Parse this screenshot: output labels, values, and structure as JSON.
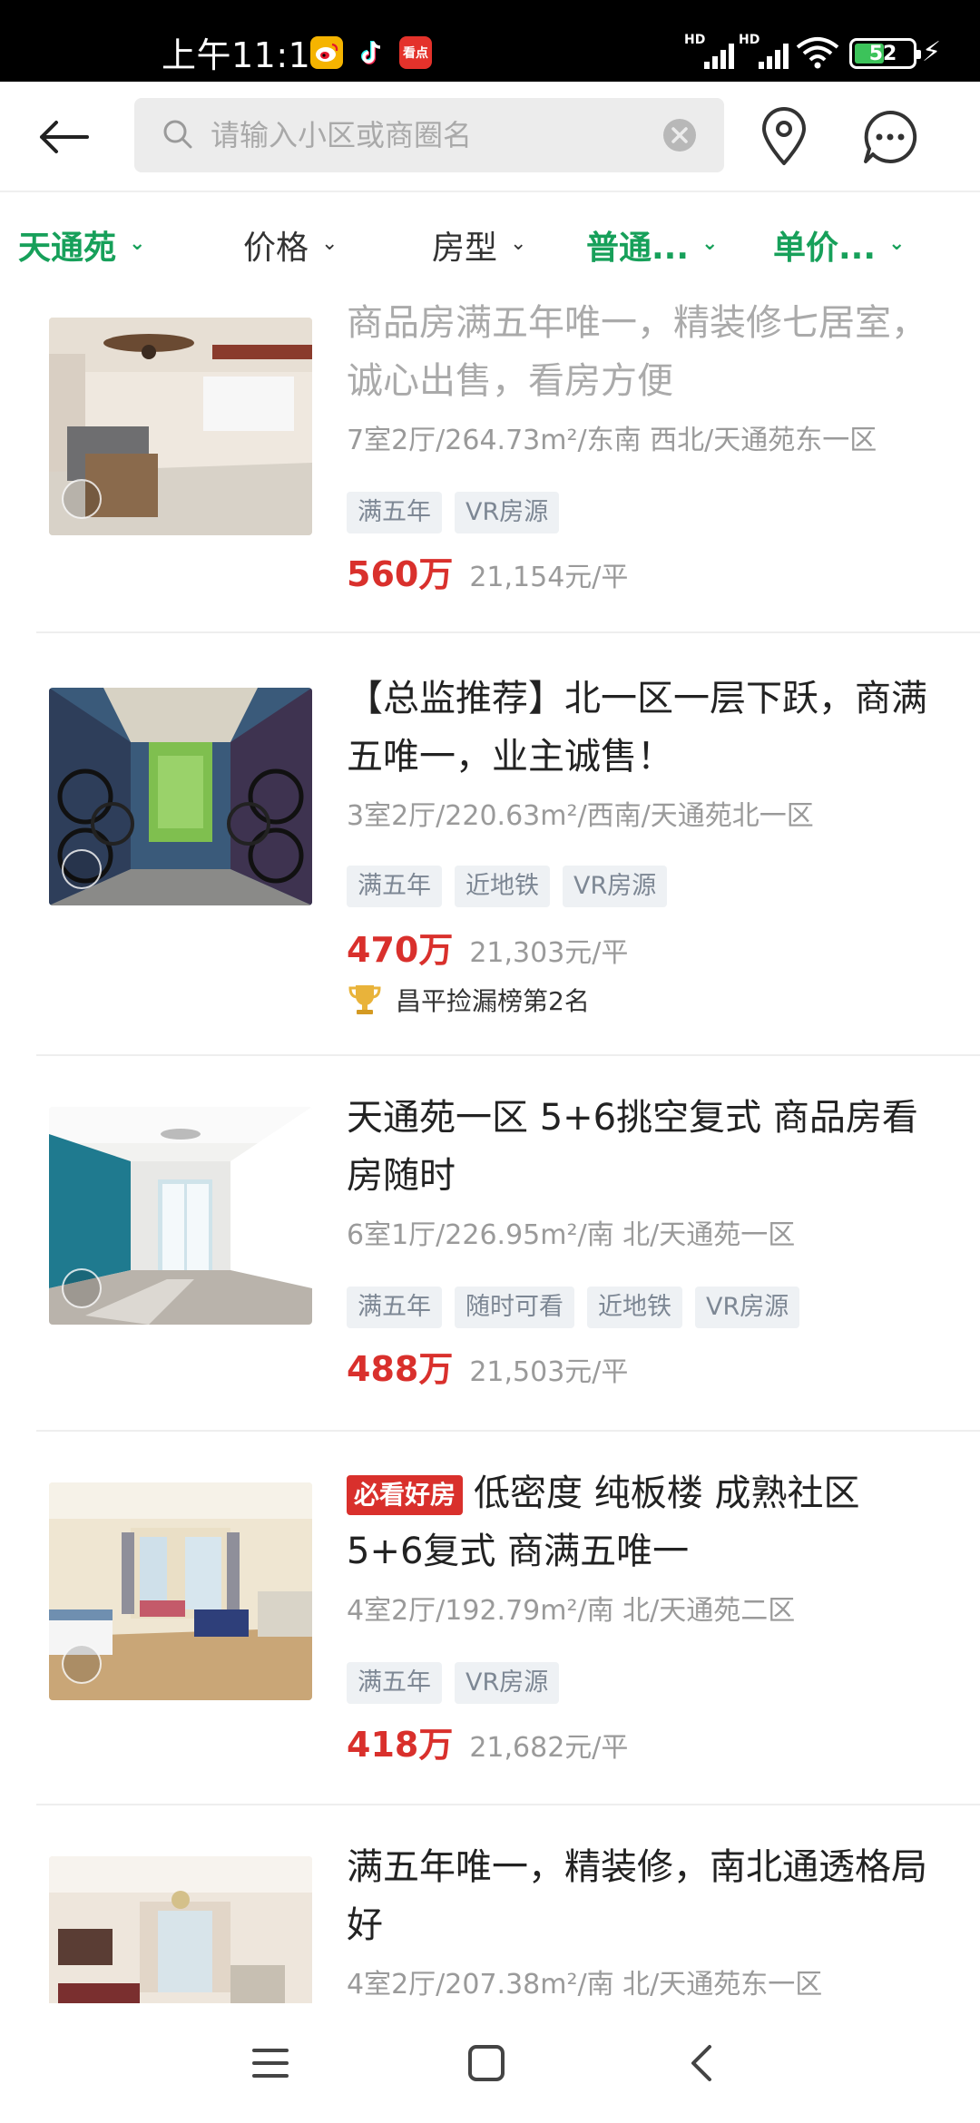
{
  "status_bar": {
    "time": "上午11:10",
    "weibo_icon": "weibo-icon",
    "tiktok_icon": "tiktok-icon",
    "kandian_label": "看点",
    "signal_label_1": "HD",
    "signal_label_2": "HD",
    "battery_level": "52",
    "battery_fraction": 0.52
  },
  "header": {
    "back_icon": "arrow-left-icon",
    "search_placeholder": "请输入小区或商圈名",
    "location_icon": "location-pin-icon",
    "message_icon": "chat-bubble-icon"
  },
  "filters": [
    {
      "label": "天通苑",
      "active": true
    },
    {
      "label": "价格",
      "active": false
    },
    {
      "label": "房型",
      "active": false
    },
    {
      "label": "普通...",
      "active": true
    },
    {
      "label": "单价...",
      "active": true
    }
  ],
  "colors": {
    "accent_green": "#17a05a",
    "price_red": "#d9302c",
    "tag_bg": "#eef1f4",
    "tag_text": "#7d8794"
  },
  "listings": [
    {
      "title": "商品房满五年唯一，精装修七居室，诚心出售，看房方便",
      "meta": "7室2厅/264.73m²/东南 西北/天通苑东一区",
      "tags": [
        "满五年",
        "VR房源"
      ],
      "price": "560万",
      "unit_price": "21,154元/平"
    },
    {
      "title": "【总监推荐】北一区一层下跃，商满五唯一，业主诚售！",
      "meta": "3室2厅/220.63m²/西南/天通苑北一区",
      "tags": [
        "满五年",
        "近地铁",
        "VR房源"
      ],
      "price": "470万",
      "unit_price": "21,303元/平",
      "rank": "昌平捡漏榜第2名"
    },
    {
      "title": "天通苑一区 5+6挑空复式 商品房看房随时",
      "meta": "6室1厅/226.95m²/南 北/天通苑一区",
      "tags": [
        "满五年",
        "随时可看",
        "近地铁",
        "VR房源"
      ],
      "price": "488万",
      "unit_price": "21,503元/平"
    },
    {
      "badge": "必看好房",
      "title": "低密度 纯板楼 成熟社区 5+6复式 商满五唯一",
      "meta": "4室2厅/192.79m²/南 北/天通苑二区",
      "tags": [
        "满五年",
        "VR房源"
      ],
      "price": "418万",
      "unit_price": "21,682元/平"
    },
    {
      "title": "满五年唯一，精装修，南北通透格局好",
      "meta": "4室2厅/207.38m²/南 北/天通苑东一区"
    }
  ],
  "nav_bar": {
    "menu_icon": "menu-icon",
    "home_icon": "home-square-icon",
    "back_icon": "back-triangle-icon"
  }
}
